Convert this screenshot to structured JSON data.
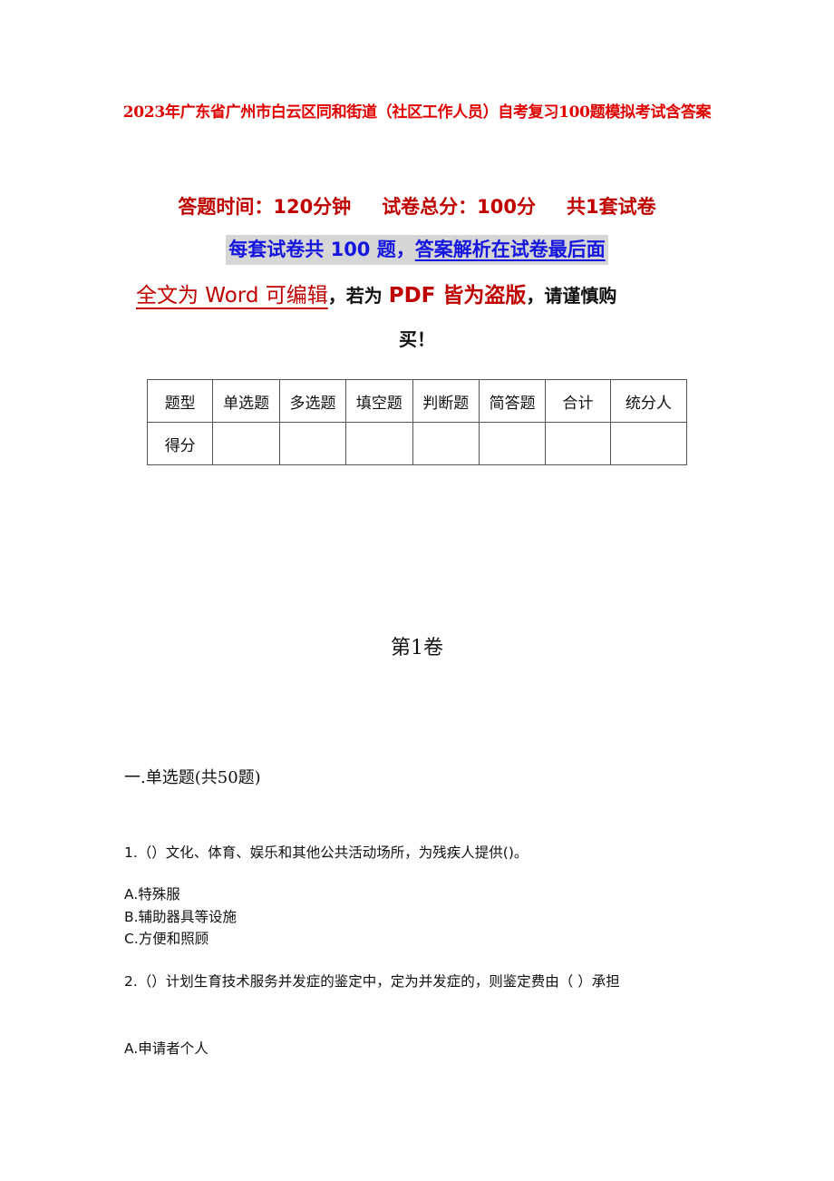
{
  "document": {
    "title": "2023年广东省广州市白云区同和街道（社区工作人员）自考复习100题模拟考试含答案",
    "info": {
      "time_label": "答题时间：120分钟",
      "score_label": "试卷总分：100分",
      "sets_label": "共1套试卷"
    },
    "banner": {
      "part1": "每套试卷共 100 题，",
      "part2": "答案解析在试卷最后面"
    },
    "notice": {
      "red_underlined": "全文为 Word 可编辑",
      "comma1": "，",
      "black1": "若为 ",
      "red_bold": "PDF 皆为盗版",
      "comma2": "，",
      "black2": "请谨慎购",
      "line2": "买！"
    },
    "score_table": {
      "header": [
        "题型",
        "单选题",
        "多选题",
        "填空题",
        "判断题",
        "简答题",
        "合计",
        "统分人"
      ],
      "row": [
        "得分",
        "",
        "",
        "",
        "",
        "",
        "",
        ""
      ]
    },
    "volume_title": "第1卷",
    "part_title": "一.单选题(共50题)",
    "questions": [
      {
        "text": "1.（）文化、体育、娱乐和其他公共活动场所，为残疾人提供()。",
        "options": [
          "A.特殊服",
          "B.辅助器具等设施",
          "C.方便和照顾"
        ]
      },
      {
        "text": "2.（）计划生育技术服务并发症的鉴定中，定为并发症的，则鉴定费由（  ）承担",
        "options": [
          "A.申请者个人"
        ]
      }
    ]
  }
}
